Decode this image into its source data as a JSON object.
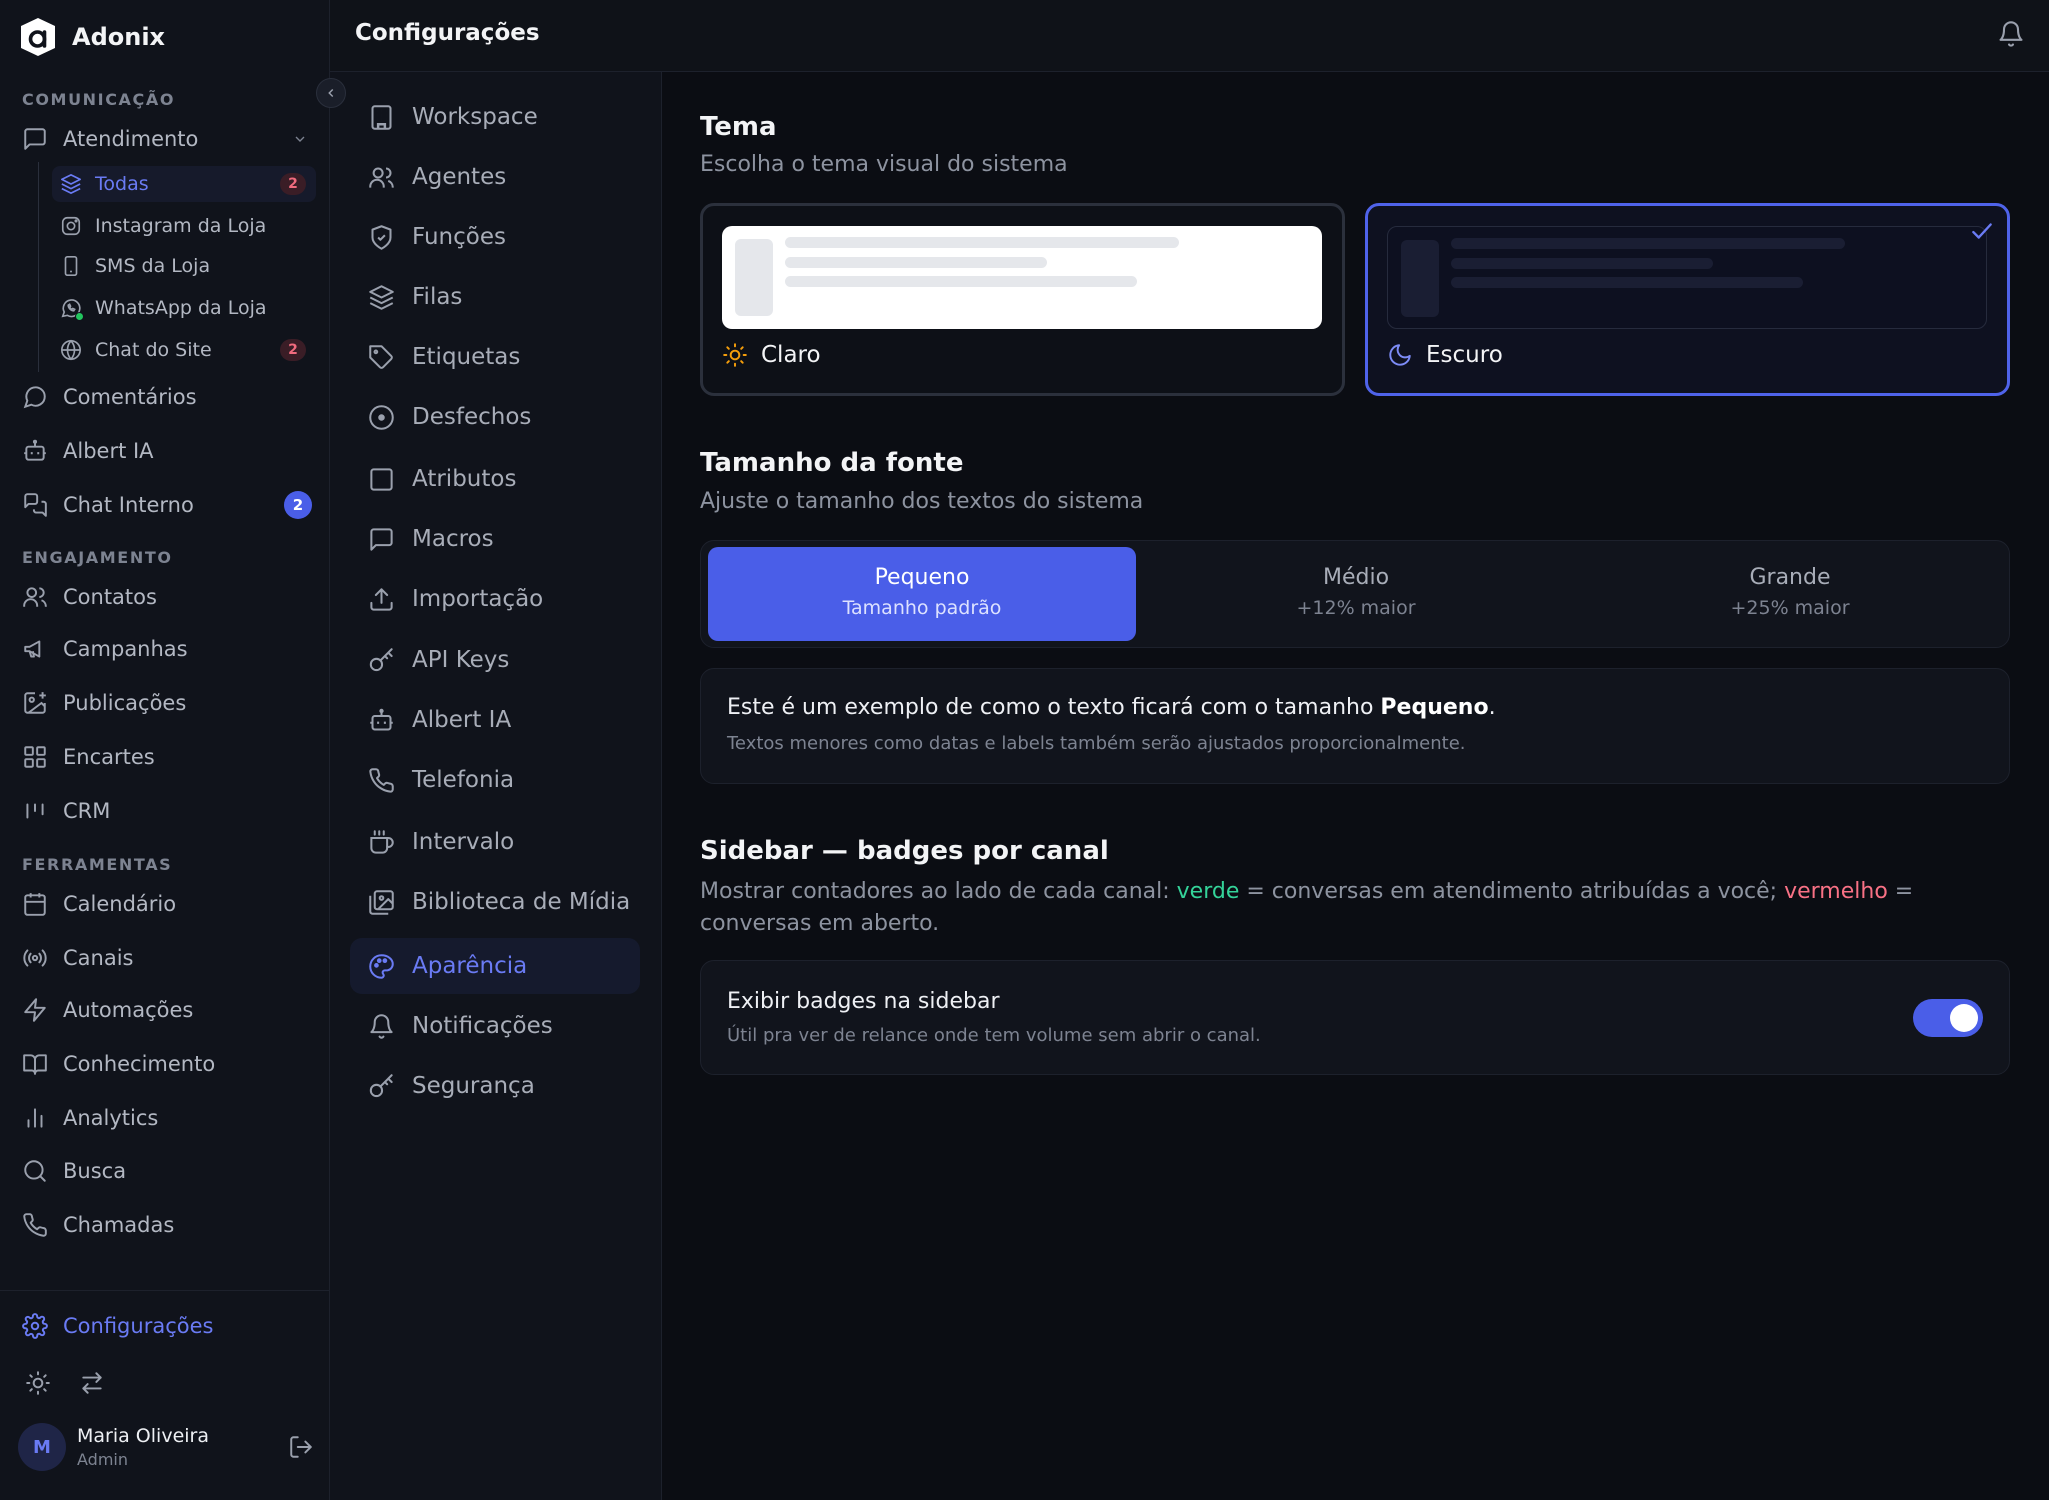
{
  "app": {
    "name": "Adonix"
  },
  "sidebar": {
    "sections": {
      "comunicacao": "COMUNICAÇÃO",
      "engajamento": "ENGAJAMENTO",
      "ferramentas": "FERRAMENTAS"
    },
    "atendimento": {
      "label": "Atendimento",
      "children": [
        {
          "label": "Todas",
          "badge": "2",
          "icon": "layers-icon"
        },
        {
          "label": "Instagram da Loja",
          "icon": "instagram-icon"
        },
        {
          "label": "SMS da Loja",
          "icon": "phone-device-icon"
        },
        {
          "label": "WhatsApp da Loja",
          "icon": "whatsapp-icon"
        },
        {
          "label": "Chat do Site",
          "badge": "2",
          "icon": "globe-icon"
        }
      ]
    },
    "comunicacao_items": [
      {
        "label": "Comentários",
        "icon": "message-circle-icon"
      },
      {
        "label": "Albert IA",
        "icon": "bot-icon"
      },
      {
        "label": "Chat Interno",
        "badge": "2",
        "icon": "chat-bubbles-icon"
      }
    ],
    "engajamento_items": [
      {
        "label": "Contatos",
        "icon": "users-icon"
      },
      {
        "label": "Campanhas",
        "icon": "megaphone-icon"
      },
      {
        "label": "Publicações",
        "icon": "image-plus-icon"
      },
      {
        "label": "Encartes",
        "icon": "grid-icon"
      },
      {
        "label": "CRM",
        "icon": "kanban-icon"
      }
    ],
    "ferramentas_items": [
      {
        "label": "Calendário",
        "icon": "calendar-icon"
      },
      {
        "label": "Canais",
        "icon": "radio-icon"
      },
      {
        "label": "Automações",
        "icon": "zap-icon"
      },
      {
        "label": "Conhecimento",
        "icon": "book-icon"
      },
      {
        "label": "Analytics",
        "icon": "bar-chart-icon"
      },
      {
        "label": "Busca",
        "icon": "search-icon"
      },
      {
        "label": "Chamadas",
        "icon": "phone-icon"
      }
    ],
    "settings_label": "Configurações",
    "user": {
      "initial": "M",
      "name": "Maria Oliveira",
      "role": "Admin"
    }
  },
  "header": {
    "title": "Configurações"
  },
  "settings_nav": [
    {
      "label": "Workspace",
      "icon": "building-icon"
    },
    {
      "label": "Agentes",
      "icon": "users-icon"
    },
    {
      "label": "Funções",
      "icon": "shield-check-icon"
    },
    {
      "label": "Filas",
      "icon": "layers-icon"
    },
    {
      "label": "Etiquetas",
      "icon": "tag-icon"
    },
    {
      "label": "Desfechos",
      "icon": "target-icon"
    },
    {
      "label": "Atributos",
      "icon": "square-icon"
    },
    {
      "label": "Macros",
      "icon": "message-square-icon"
    },
    {
      "label": "Importação",
      "icon": "upload-icon"
    },
    {
      "label": "API Keys",
      "icon": "key-icon"
    },
    {
      "label": "Albert IA",
      "icon": "bot-icon"
    },
    {
      "label": "Telefonia",
      "icon": "phone-icon"
    },
    {
      "label": "Intervalo",
      "icon": "coffee-icon"
    },
    {
      "label": "Biblioteca de Mídia",
      "icon": "images-icon"
    },
    {
      "label": "Aparência",
      "icon": "palette-icon",
      "active": true
    },
    {
      "label": "Notificações",
      "icon": "bell-icon"
    },
    {
      "label": "Segurança",
      "icon": "key-icon"
    }
  ],
  "theme": {
    "title": "Tema",
    "description": "Escolha o tema visual do sistema",
    "options": [
      {
        "label": "Claro",
        "icon": "sun-icon"
      },
      {
        "label": "Escuro",
        "icon": "moon-icon",
        "selected": true
      }
    ]
  },
  "font_size": {
    "title": "Tamanho da fonte",
    "description": "Ajuste o tamanho dos textos do sistema",
    "options": [
      {
        "label": "Pequeno",
        "sub": "Tamanho padrão",
        "selected": true
      },
      {
        "label": "Médio",
        "sub": "+12% maior"
      },
      {
        "label": "Grande",
        "sub": "+25% maior"
      }
    ],
    "example_prefix": "Este é um exemplo de como o texto ficará com o tamanho ",
    "example_bold": "Pequeno",
    "example_suffix": ".",
    "example_note": "Textos menores como datas e labels também serão ajustados proporcionalmente."
  },
  "badges": {
    "title": "Sidebar — badges por canal",
    "desc_1": "Mostrar contadores ao lado de cada canal: ",
    "green_word": "verde",
    "desc_2": " = conversas em atendimento atribuídas a você; ",
    "red_word": "vermelho",
    "desc_3": " = conversas em aberto.",
    "toggle_label": "Exibir badges na sidebar",
    "toggle_desc": "Útil pra ver de relance onde tem volume sem abrir o canal.",
    "toggle_on": true
  },
  "colors": {
    "accent": "#4a5ee8",
    "accent_text": "#6a7bf4",
    "green": "#34d399",
    "red": "#f87185"
  }
}
